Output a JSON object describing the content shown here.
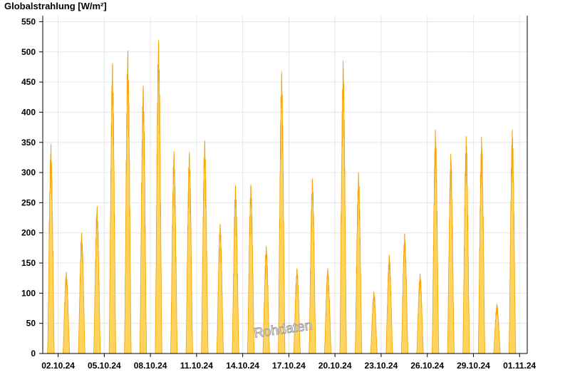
{
  "chart_data": {
    "type": "area",
    "ylabel": "Globalstrahlung [W/m²]",
    "xlabel": "",
    "title": "",
    "watermark": "Rohdaten",
    "ylim": [
      0,
      560
    ],
    "yticks": [
      0,
      50,
      100,
      150,
      200,
      250,
      300,
      350,
      400,
      450,
      500,
      550
    ],
    "xlim": [
      "2024-10-01T00:00",
      "2024-11-01T12:00"
    ],
    "xticks": [
      {
        "date": "2024-10-02",
        "label": "02.10.24"
      },
      {
        "date": "2024-10-05",
        "label": "05.10.24"
      },
      {
        "date": "2024-10-08",
        "label": "08.10.24"
      },
      {
        "date": "2024-10-11",
        "label": "11.10.24"
      },
      {
        "date": "2024-10-14",
        "label": "14.10.24"
      },
      {
        "date": "2024-10-17",
        "label": "17.10.24"
      },
      {
        "date": "2024-10-20",
        "label": "20.10.24"
      },
      {
        "date": "2024-10-23",
        "label": "23.10.24"
      },
      {
        "date": "2024-10-26",
        "label": "26.10.24"
      },
      {
        "date": "2024-10-29",
        "label": "29.10.24"
      },
      {
        "date": "2024-11-01",
        "label": "01.11.24"
      }
    ],
    "grid": true,
    "colors": {
      "fill": "#ffd45c",
      "line": "#f5a000",
      "grid": "#e6e6e6",
      "axis": "#000000"
    },
    "series": [
      {
        "daily_peaks": [
          {
            "date": "2024-10-01",
            "peak": 347
          },
          {
            "date": "2024-10-02",
            "peak": 135
          },
          {
            "date": "2024-10-03",
            "peak": 200
          },
          {
            "date": "2024-10-04",
            "peak": 244
          },
          {
            "date": "2024-10-05",
            "peak": 481
          },
          {
            "date": "2024-10-06",
            "peak": 502
          },
          {
            "date": "2024-10-07",
            "peak": 444
          },
          {
            "date": "2024-10-08",
            "peak": 520
          },
          {
            "date": "2024-10-09",
            "peak": 335
          },
          {
            "date": "2024-10-10",
            "peak": 334
          },
          {
            "date": "2024-10-11",
            "peak": 353
          },
          {
            "date": "2024-10-12",
            "peak": 215
          },
          {
            "date": "2024-10-13",
            "peak": 278
          },
          {
            "date": "2024-10-14",
            "peak": 280
          },
          {
            "date": "2024-10-15",
            "peak": 178
          },
          {
            "date": "2024-10-16",
            "peak": 467
          },
          {
            "date": "2024-10-17",
            "peak": 141
          },
          {
            "date": "2024-10-18",
            "peak": 290
          },
          {
            "date": "2024-10-19",
            "peak": 141
          },
          {
            "date": "2024-10-20",
            "peak": 485
          },
          {
            "date": "2024-10-21",
            "peak": 300
          },
          {
            "date": "2024-10-22",
            "peak": 102
          },
          {
            "date": "2024-10-23",
            "peak": 163
          },
          {
            "date": "2024-10-24",
            "peak": 199
          },
          {
            "date": "2024-10-25",
            "peak": 132
          },
          {
            "date": "2024-10-26",
            "peak": 371
          },
          {
            "date": "2024-10-27",
            "peak": 331
          },
          {
            "date": "2024-10-28",
            "peak": 360
          },
          {
            "date": "2024-10-29",
            "peak": 359
          },
          {
            "date": "2024-10-30",
            "peak": 82
          },
          {
            "date": "2024-10-31",
            "peak": 371
          }
        ]
      }
    ]
  }
}
